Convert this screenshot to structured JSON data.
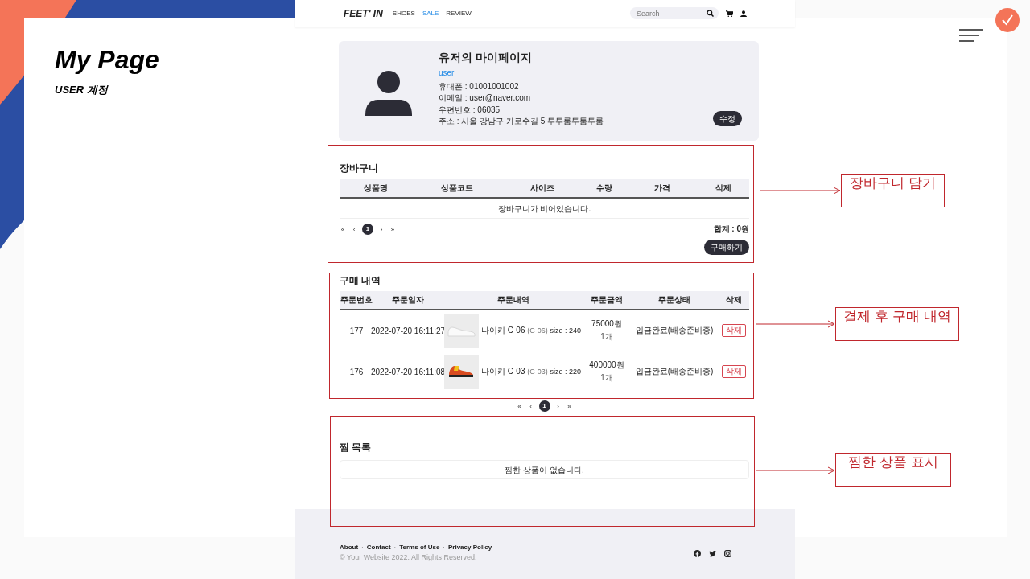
{
  "slide": {
    "title": "My Page",
    "subtitle": "USER 계정"
  },
  "site": {
    "logo": "FEET' IN",
    "nav": [
      {
        "label": "SHOES",
        "selected": false
      },
      {
        "label": "SALE",
        "selected": true
      },
      {
        "label": "REVIEW",
        "selected": false
      }
    ],
    "search": {
      "placeholder": "Search"
    },
    "profile": {
      "title": "유저의 마이페이지",
      "role": "user",
      "fields": [
        "휴대폰 : 01001001002",
        "이메일 : user@naver.com",
        "우편번호 : 06035",
        "주소 : 서울 강남구 가로수길 5 투투룸투툼투룸"
      ],
      "edit_button": "수정"
    },
    "cart": {
      "title": "장바구니",
      "columns": [
        "상품명",
        "상품코드",
        "사이즈",
        "수량",
        "가격",
        "삭제"
      ],
      "empty_message": "장바구니가 비어있습니다.",
      "pagination": {
        "first": "«",
        "prev": "‹",
        "pages": [
          {
            "label": "1",
            "selected": true
          }
        ],
        "next": "›",
        "last": "»"
      },
      "total": "합계 : 0원",
      "buy_button": "구매하기"
    },
    "orders": {
      "title": "구매 내역",
      "columns": [
        "주문번호",
        "주문일자",
        "주문내역",
        "주문금액",
        "주문상태",
        "삭제"
      ],
      "rows": [
        {
          "number": "177",
          "date": "2022-07-20 16:11:27",
          "name": "나이키 C-06",
          "code": "(C-06)",
          "size": "size : 240",
          "price": "75000원",
          "quantity": "1개",
          "status": "입금완료(배송준비중)",
          "delete_button": "삭제"
        },
        {
          "number": "176",
          "date": "2022-07-20 16:11:08",
          "name": "나이키 C-03",
          "code": "(C-03)",
          "size": "size : 220",
          "price": "400000원",
          "quantity": "1개",
          "status": "입금완료(배송준비중)",
          "delete_button": "삭제"
        }
      ],
      "pagination": {
        "first": "«",
        "prev": "‹",
        "pages": [
          {
            "label": "1",
            "selected": true
          }
        ],
        "next": "›",
        "last": "»"
      }
    },
    "wishlist": {
      "title": "찜 목록",
      "empty_message": "찜한 상품이 없습니다."
    },
    "footer": {
      "links": [
        "About",
        "Contact",
        "Terms of Use",
        "Privacy Policy"
      ],
      "separator": "·",
      "copyright": "© Your Website 2022. All Rights Reserved."
    }
  },
  "annotations": [
    {
      "label": "장바구니 담기"
    },
    {
      "label": "결제 후 구매 내역"
    },
    {
      "label": "찜한 상품 표시"
    }
  ]
}
